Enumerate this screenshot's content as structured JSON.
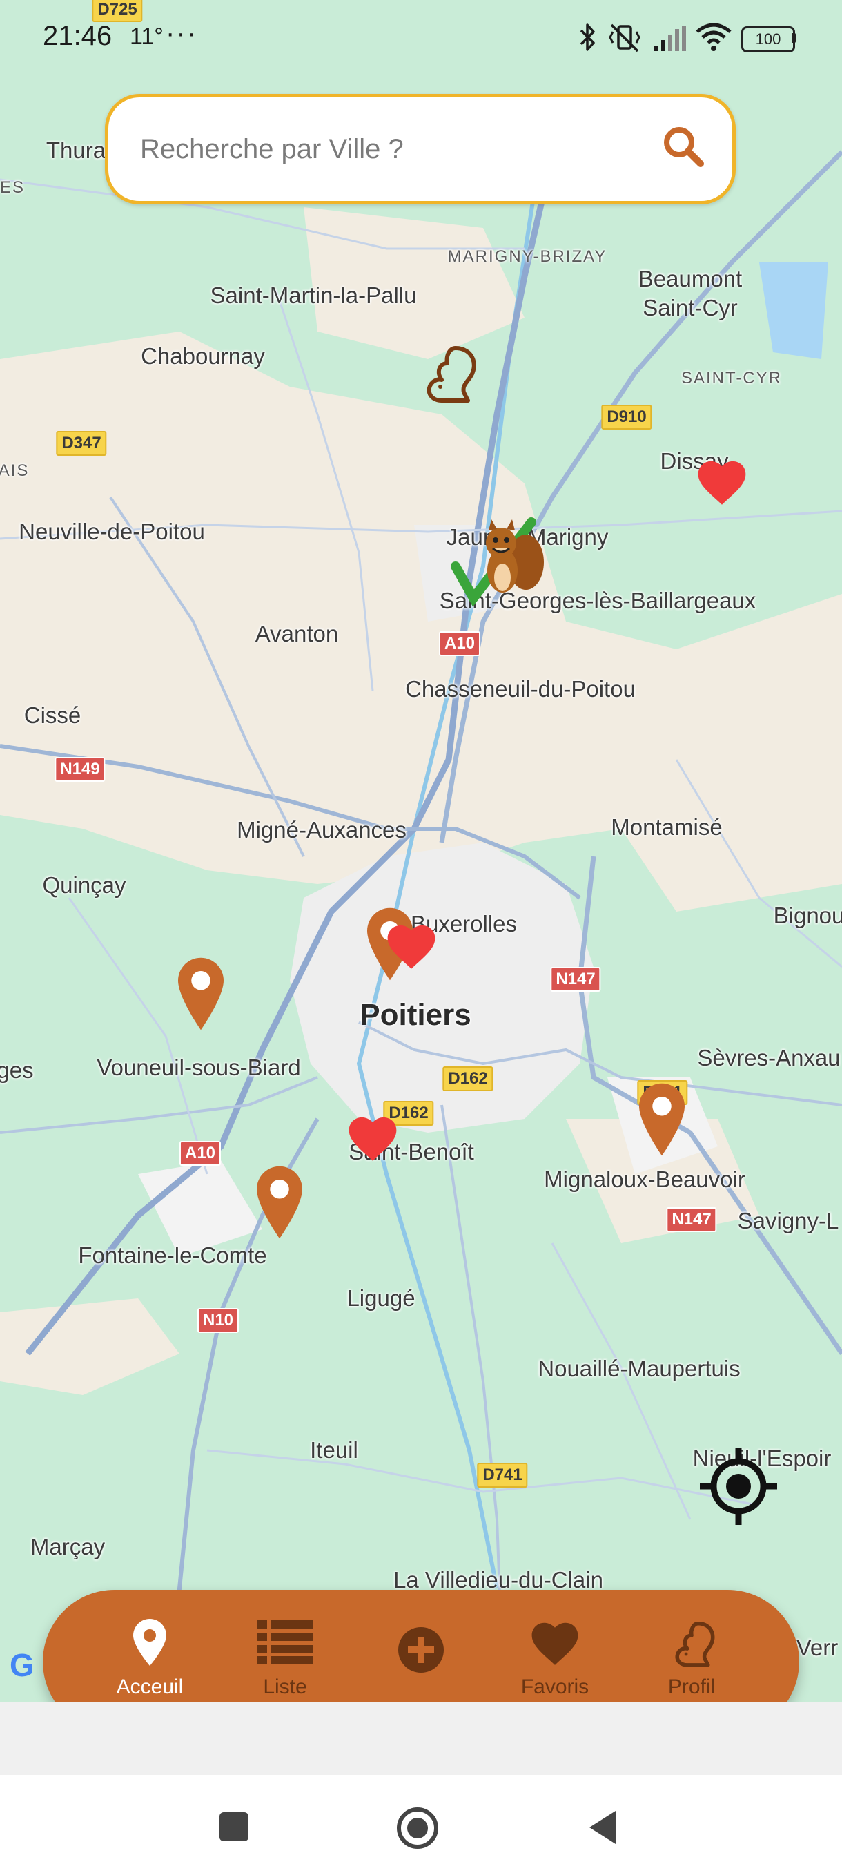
{
  "status_bar": {
    "time": "21:46",
    "temperature": "11°",
    "more": "···",
    "battery": "100"
  },
  "search": {
    "placeholder": "Recherche par Ville ?"
  },
  "map": {
    "road_color": "#9fb6d6",
    "urban_color": "#f2ece1",
    "green_color": "#c9ecd7",
    "places": [
      {
        "name": "Thura",
        "style": "normal"
      },
      {
        "name": "ES",
        "style": "caps"
      },
      {
        "name": "MARIGNY-BRIZAY",
        "style": "caps"
      },
      {
        "name": "Beaumont",
        "style": "normal"
      },
      {
        "name": "Saint-Cyr",
        "style": "normal"
      },
      {
        "name": "Saint-Martin-la-Pallu",
        "style": "normal"
      },
      {
        "name": "Chabournay",
        "style": "normal"
      },
      {
        "name": "SAINT-CYR",
        "style": "caps"
      },
      {
        "name": "Dissay",
        "style": "normal"
      },
      {
        "name": "AIS",
        "style": "caps"
      },
      {
        "name": "Neuville-de-Poitou",
        "style": "normal"
      },
      {
        "name": "Jaunay-Marigny",
        "style": "normal"
      },
      {
        "name": "Saint-Georges-lès-Baillargeaux",
        "style": "normal"
      },
      {
        "name": "Avanton",
        "style": "normal"
      },
      {
        "name": "Chasseneuil-du-Poitou",
        "style": "normal"
      },
      {
        "name": "Cissé",
        "style": "normal"
      },
      {
        "name": "Migné-Auxances",
        "style": "normal"
      },
      {
        "name": "Montamisé",
        "style": "normal"
      },
      {
        "name": "Quinçay",
        "style": "normal"
      },
      {
        "name": "Buxerolles",
        "style": "normal"
      },
      {
        "name": "Bignou",
        "style": "normal"
      },
      {
        "name": "Poitiers",
        "style": "big"
      },
      {
        "name": "Vouneuil-sous-Biard",
        "style": "normal"
      },
      {
        "name": "ges",
        "style": "normal"
      },
      {
        "name": "Sèvres-Anxau",
        "style": "normal"
      },
      {
        "name": "Saint-Benoît",
        "style": "normal"
      },
      {
        "name": "Mignaloux-Beauvoir",
        "style": "normal"
      },
      {
        "name": "Savigny-L",
        "style": "normal"
      },
      {
        "name": "Fontaine-le-Comte",
        "style": "normal"
      },
      {
        "name": "Ligugé",
        "style": "normal"
      },
      {
        "name": "Nouaillé-Maupertuis",
        "style": "normal"
      },
      {
        "name": "Iteuil",
        "style": "normal"
      },
      {
        "name": "Nieuil-l'Espoir",
        "style": "normal"
      },
      {
        "name": "Marçay",
        "style": "normal"
      },
      {
        "name": "La Villedieu-du-Clain",
        "style": "normal"
      },
      {
        "name": "Verr",
        "style": "normal"
      }
    ],
    "road_shields": [
      {
        "label": "D725",
        "color": "yellow"
      },
      {
        "label": "D910",
        "color": "yellow"
      },
      {
        "label": "D347",
        "color": "yellow"
      },
      {
        "label": "A10",
        "color": "red"
      },
      {
        "label": "N149",
        "color": "red"
      },
      {
        "label": "N147",
        "color": "red"
      },
      {
        "label": "D162",
        "color": "yellow"
      },
      {
        "label": "D162",
        "color": "yellow"
      },
      {
        "label": "D741",
        "color": "yellow"
      },
      {
        "label": "A10",
        "color": "red"
      },
      {
        "label": "N147",
        "color": "red"
      },
      {
        "label": "N10",
        "color": "red"
      },
      {
        "label": "D741",
        "color": "yellow"
      }
    ],
    "markers": [
      {
        "type": "squirrel-icon",
        "color": "#7a3b12"
      },
      {
        "type": "squirrel-mascot-check",
        "color": "#b0651f"
      },
      {
        "type": "heart-icon",
        "color": "#f03a3a"
      },
      {
        "type": "pin-icon",
        "color": "#c8692b"
      },
      {
        "type": "heart-icon",
        "color": "#f03a3a"
      },
      {
        "type": "pin-icon",
        "color": "#c8692b"
      },
      {
        "type": "heart-icon",
        "color": "#f03a3a"
      },
      {
        "type": "pin-icon",
        "color": "#c8692b"
      },
      {
        "type": "pin-icon",
        "color": "#c8692b"
      }
    ],
    "google_logo": "G"
  },
  "bottom_nav": {
    "background": "#c8692b",
    "items": [
      {
        "label": "Acceuil",
        "icon": "map-pin-icon",
        "active": true
      },
      {
        "label": "Liste",
        "icon": "list-icon",
        "active": false
      },
      {
        "label": "",
        "icon": "add-circle-icon",
        "active": false
      },
      {
        "label": "Favoris",
        "icon": "heart-icon",
        "active": false
      },
      {
        "label": "Profil",
        "icon": "squirrel-icon",
        "active": false
      }
    ]
  },
  "system_nav": {
    "buttons": [
      "recents-button",
      "home-button",
      "back-button"
    ]
  }
}
